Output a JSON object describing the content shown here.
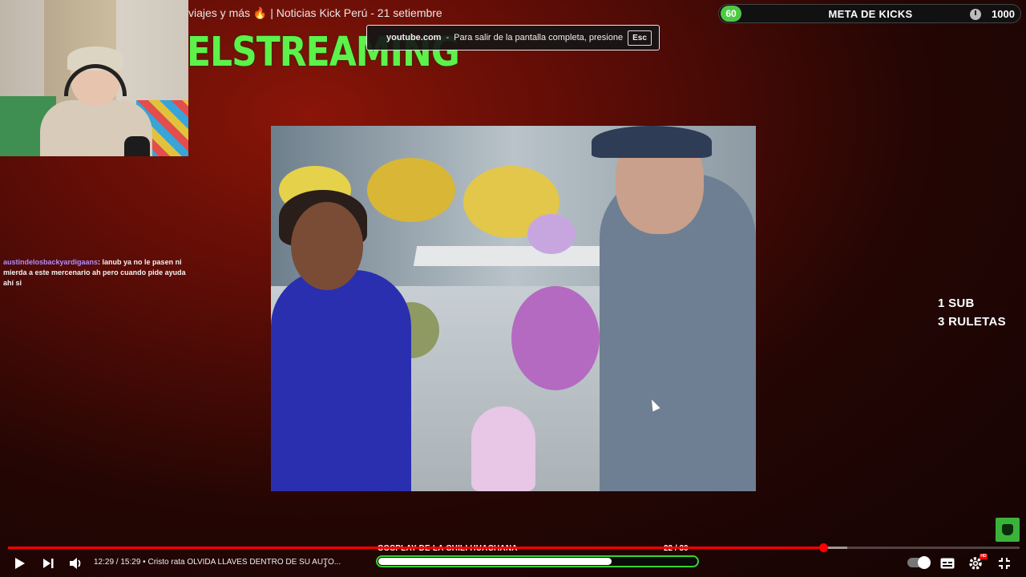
{
  "webcam": {},
  "header": {
    "video_title": "viajes y más 🔥 | Noticias Kick Perú - 21 setiembre",
    "brand_logo_text": "ELSTREAMING"
  },
  "fullscreen_notice": {
    "domain": "youtube.com",
    "separator": "-",
    "message": "Para salir de la pantalla completa, presione",
    "key": "Esc"
  },
  "kicks_goal": {
    "current": "60",
    "title": "META DE KICKS",
    "target": "1000",
    "progress_fraction": 0.06,
    "accent_color": "#4fc944"
  },
  "chat": {
    "username": "austindelosbackyardigaans",
    "message": ": lanub ya no le pasen ni mierda a este mercenario ah pero cuando pide ayuda ahí si",
    "username_color": "#b08cff"
  },
  "side_promo": {
    "line1": "1 SUB",
    "line2": "3 RULETAS"
  },
  "overlay_goal": {
    "label": "COSPLAY DE LA CHILI HUACHANA",
    "current": "22",
    "separator": " / ",
    "total": "30",
    "fraction": 0.733,
    "color": "#38d430"
  },
  "player": {
    "time_display": "12:29 / 15:29",
    "chapter_separator": "•",
    "chapter_title": "Cristo rata OLVIDA LLAVES DENTRO DE SU AUTO...",
    "played_fraction": 0.806,
    "buffered_fraction": 0.83,
    "progress_color": "#ff0000",
    "icons": {
      "play": "play-icon",
      "next": "next-icon",
      "volume": "volume-icon",
      "autoplay": "autoplay-toggle",
      "subtitles": "subtitles-icon",
      "settings": "settings-icon",
      "exit_fullscreen": "exit-fullscreen-icon"
    },
    "hd_label": "HD"
  }
}
